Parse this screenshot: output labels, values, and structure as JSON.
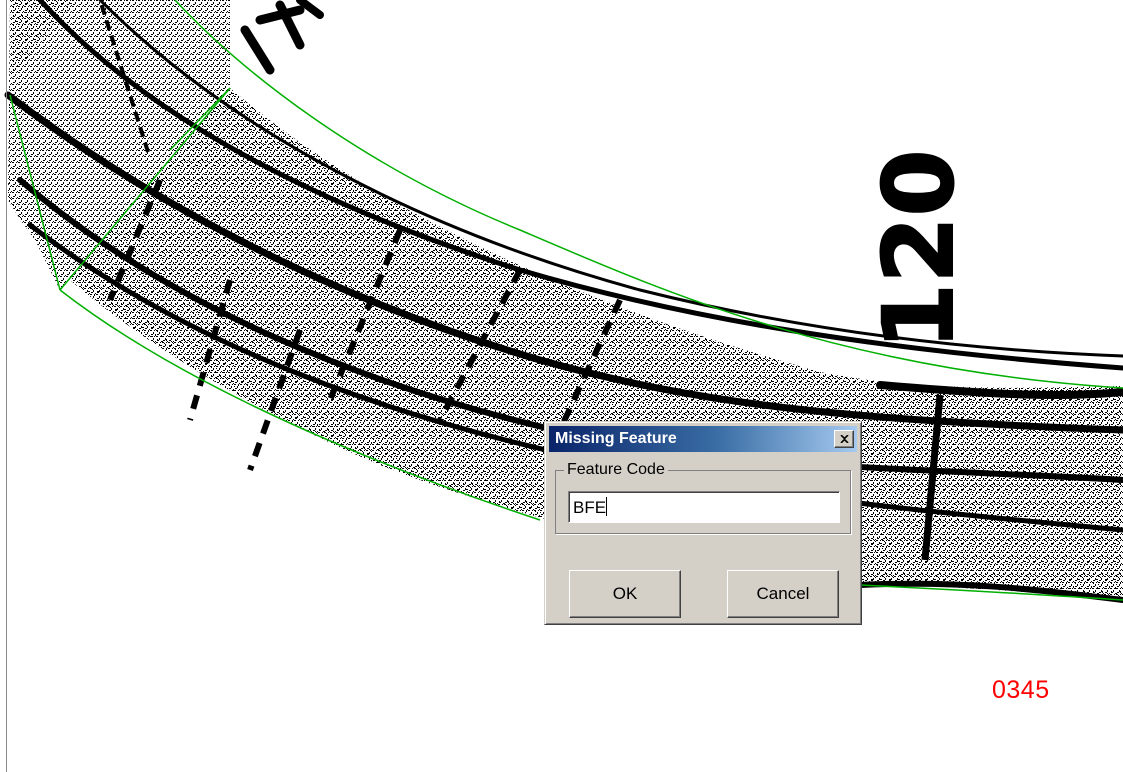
{
  "map": {
    "road_label": "120",
    "sheet_number": "0345",
    "colors": {
      "boundary": "#00b000",
      "ink": "#000000",
      "sheet_number": "#ff0000"
    }
  },
  "dialog": {
    "title": "Missing Feature",
    "group_label": "Feature Code",
    "input_value": "BFE",
    "ok_label": "OK",
    "cancel_label": "Cancel",
    "close_icon": "close-icon"
  }
}
